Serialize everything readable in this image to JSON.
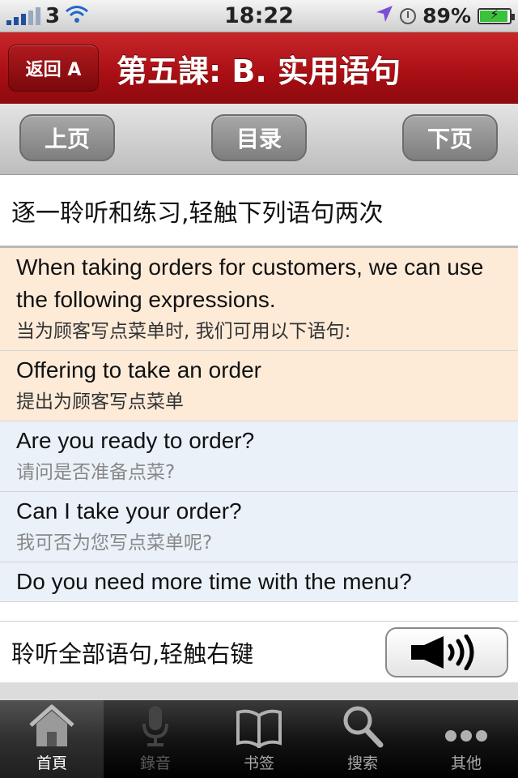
{
  "status_bar": {
    "carrier": "3",
    "time": "18:22",
    "battery_percent": "89%",
    "battery_level": 0.89
  },
  "header": {
    "back_label": "返回 A",
    "title": "第五課: B. 实用语句"
  },
  "nav": {
    "prev_label": "上页",
    "toc_label": "目录",
    "next_label": "下页"
  },
  "instruction": "逐一聆听和练习,轻触下列语句两次",
  "intro": {
    "en": "When taking orders for customers, we can use the following expressions.",
    "zh": "当为顾客写点菜单时, 我们可用以下语句:"
  },
  "section": {
    "en": "Offering to take an order",
    "zh": "提出为顾客写点菜单"
  },
  "sentences": [
    {
      "en": "Are you ready to order?",
      "zh": "请问是否准备点菜?"
    },
    {
      "en": "Can I take your order?",
      "zh": "我可否为您写点菜单呢?"
    },
    {
      "en": "Do you need more time with the menu?",
      "zh": ""
    }
  ],
  "listen_all": {
    "label": "聆听全部语句,轻触右键",
    "button_icon": "speaker-icon"
  },
  "tabs": [
    {
      "label": "首頁",
      "icon": "home-icon"
    },
    {
      "label": "錄音",
      "icon": "microphone-icon"
    },
    {
      "label": "书签",
      "icon": "book-icon"
    },
    {
      "label": "搜索",
      "icon": "search-icon"
    },
    {
      "label": "其他",
      "icon": "more-icon"
    }
  ],
  "colors": {
    "title_bar": "#a80e14",
    "intro_bg": "#fdebd8",
    "sentence_bg": "#eaf1f9"
  }
}
